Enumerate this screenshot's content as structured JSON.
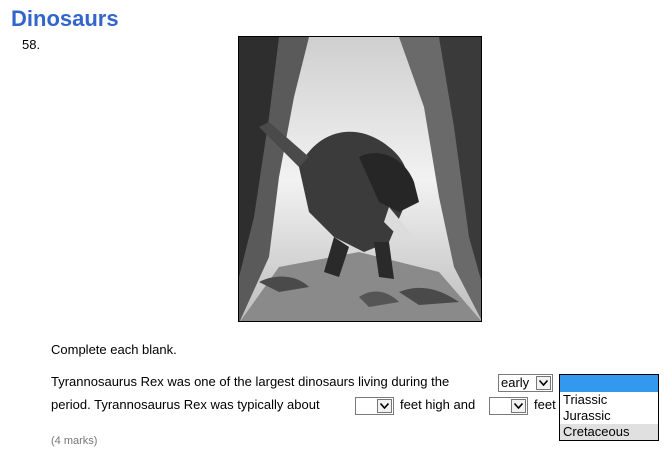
{
  "page": {
    "title": "Dinosaurs",
    "question_number": "58."
  },
  "illustration": {
    "subject": "tyrannosaurus-rex-canyon-illustration"
  },
  "question": {
    "instruction": "Complete each blank.",
    "line1_text": "Tyrannosaurus Rex was one of the largest dinosaurs living during the",
    "select_era_value": "early",
    "line2_text_a": "period. Tyrannosaurus Rex was typically about",
    "line2_text_b": "feet high and",
    "line2_text_c": "feet",
    "marks": "(4 marks)"
  },
  "dropdown": {
    "options": [
      "",
      "Triassic",
      "Jurassic",
      "Cretaceous"
    ],
    "highlighted": "Cretaceous"
  },
  "colors": {
    "title": "#3366cc",
    "dropdown_selected": "#3399ee",
    "marks": "#777777"
  }
}
